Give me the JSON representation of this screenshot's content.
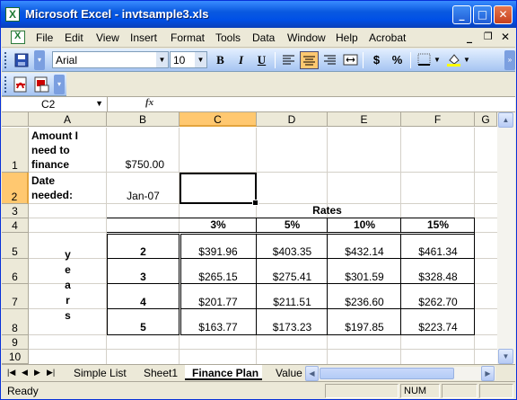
{
  "window": {
    "title": "Microsoft Excel - invtsample3.xls"
  },
  "menu": [
    "File",
    "Edit",
    "View",
    "Insert",
    "Format",
    "Tools",
    "Data",
    "Window",
    "Help",
    "Acrobat"
  ],
  "toolbar": {
    "font": "Arial",
    "size": "10",
    "bold": "B",
    "italic": "I",
    "underline": "U",
    "currency": "$",
    "percent": "%"
  },
  "formula": {
    "name_box": "C2",
    "fx": "fx",
    "content": ""
  },
  "columns": [
    "A",
    "B",
    "C",
    "D",
    "E",
    "F",
    "G"
  ],
  "rows": [
    "1",
    "2",
    "3",
    "4",
    "5",
    "6",
    "7",
    "8",
    "9",
    "10"
  ],
  "cells": {
    "A1": "Amount I need to finance",
    "A1_lines": [
      "Amount I",
      "need to",
      "finance"
    ],
    "B1": "$750.00",
    "A2_lines": [
      "Date",
      "needed:"
    ],
    "B2": "Jan-07",
    "C2": "",
    "D3": "Rates",
    "rates": [
      "3%",
      "5%",
      "10%",
      "15%"
    ],
    "years_label": [
      "y",
      "e",
      "a",
      "r",
      "s"
    ],
    "years": [
      "2",
      "3",
      "4",
      "5"
    ],
    "payments": [
      [
        "$391.96",
        "$403.35",
        "$432.14",
        "$461.34"
      ],
      [
        "$265.15",
        "$275.41",
        "$301.59",
        "$328.48"
      ],
      [
        "$201.77",
        "$211.51",
        "$236.60",
        "$262.70"
      ],
      [
        "$163.77",
        "$173.23",
        "$197.85",
        "$223.74"
      ]
    ]
  },
  "sheets": [
    "Simple List",
    "Sheet1",
    "Finance Plan",
    "Value"
  ],
  "active_sheet": "Finance Plan",
  "status": {
    "mode": "Ready",
    "num": "NUM"
  },
  "colors": {
    "title_bar": "#0a5ae0",
    "selection": "#ffc870"
  }
}
